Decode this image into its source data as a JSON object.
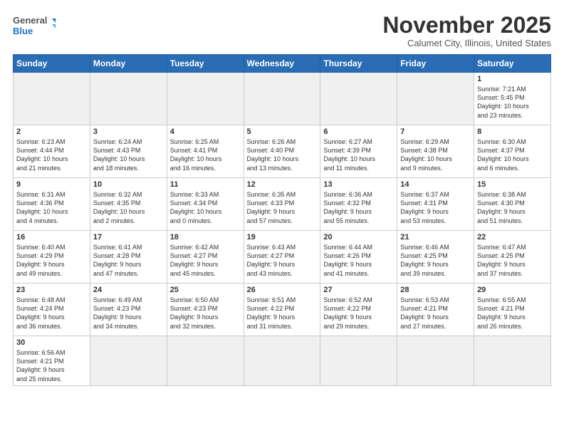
{
  "logo": {
    "text_general": "General",
    "text_blue": "Blue"
  },
  "title": "November 2025",
  "subtitle": "Calumet City, Illinois, United States",
  "weekdays": [
    "Sunday",
    "Monday",
    "Tuesday",
    "Wednesday",
    "Thursday",
    "Friday",
    "Saturday"
  ],
  "weeks": [
    [
      {
        "day": "",
        "info": ""
      },
      {
        "day": "",
        "info": ""
      },
      {
        "day": "",
        "info": ""
      },
      {
        "day": "",
        "info": ""
      },
      {
        "day": "",
        "info": ""
      },
      {
        "day": "",
        "info": ""
      },
      {
        "day": "1",
        "info": "Sunrise: 7:21 AM\nSunset: 5:45 PM\nDaylight: 10 hours\nand 23 minutes."
      }
    ],
    [
      {
        "day": "2",
        "info": "Sunrise: 6:23 AM\nSunset: 4:44 PM\nDaylight: 10 hours\nand 21 minutes."
      },
      {
        "day": "3",
        "info": "Sunrise: 6:24 AM\nSunset: 4:43 PM\nDaylight: 10 hours\nand 18 minutes."
      },
      {
        "day": "4",
        "info": "Sunrise: 6:25 AM\nSunset: 4:41 PM\nDaylight: 10 hours\nand 16 minutes."
      },
      {
        "day": "5",
        "info": "Sunrise: 6:26 AM\nSunset: 4:40 PM\nDaylight: 10 hours\nand 13 minutes."
      },
      {
        "day": "6",
        "info": "Sunrise: 6:27 AM\nSunset: 4:39 PM\nDaylight: 10 hours\nand 11 minutes."
      },
      {
        "day": "7",
        "info": "Sunrise: 6:29 AM\nSunset: 4:38 PM\nDaylight: 10 hours\nand 9 minutes."
      },
      {
        "day": "8",
        "info": "Sunrise: 6:30 AM\nSunset: 4:37 PM\nDaylight: 10 hours\nand 6 minutes."
      }
    ],
    [
      {
        "day": "9",
        "info": "Sunrise: 6:31 AM\nSunset: 4:36 PM\nDaylight: 10 hours\nand 4 minutes."
      },
      {
        "day": "10",
        "info": "Sunrise: 6:32 AM\nSunset: 4:35 PM\nDaylight: 10 hours\nand 2 minutes."
      },
      {
        "day": "11",
        "info": "Sunrise: 6:33 AM\nSunset: 4:34 PM\nDaylight: 10 hours\nand 0 minutes."
      },
      {
        "day": "12",
        "info": "Sunrise: 6:35 AM\nSunset: 4:33 PM\nDaylight: 9 hours\nand 57 minutes."
      },
      {
        "day": "13",
        "info": "Sunrise: 6:36 AM\nSunset: 4:32 PM\nDaylight: 9 hours\nand 55 minutes."
      },
      {
        "day": "14",
        "info": "Sunrise: 6:37 AM\nSunset: 4:31 PM\nDaylight: 9 hours\nand 53 minutes."
      },
      {
        "day": "15",
        "info": "Sunrise: 6:38 AM\nSunset: 4:30 PM\nDaylight: 9 hours\nand 51 minutes."
      }
    ],
    [
      {
        "day": "16",
        "info": "Sunrise: 6:40 AM\nSunset: 4:29 PM\nDaylight: 9 hours\nand 49 minutes."
      },
      {
        "day": "17",
        "info": "Sunrise: 6:41 AM\nSunset: 4:28 PM\nDaylight: 9 hours\nand 47 minutes."
      },
      {
        "day": "18",
        "info": "Sunrise: 6:42 AM\nSunset: 4:27 PM\nDaylight: 9 hours\nand 45 minutes."
      },
      {
        "day": "19",
        "info": "Sunrise: 6:43 AM\nSunset: 4:27 PM\nDaylight: 9 hours\nand 43 minutes."
      },
      {
        "day": "20",
        "info": "Sunrise: 6:44 AM\nSunset: 4:26 PM\nDaylight: 9 hours\nand 41 minutes."
      },
      {
        "day": "21",
        "info": "Sunrise: 6:46 AM\nSunset: 4:25 PM\nDaylight: 9 hours\nand 39 minutes."
      },
      {
        "day": "22",
        "info": "Sunrise: 6:47 AM\nSunset: 4:25 PM\nDaylight: 9 hours\nand 37 minutes."
      }
    ],
    [
      {
        "day": "23",
        "info": "Sunrise: 6:48 AM\nSunset: 4:24 PM\nDaylight: 9 hours\nand 36 minutes."
      },
      {
        "day": "24",
        "info": "Sunrise: 6:49 AM\nSunset: 4:23 PM\nDaylight: 9 hours\nand 34 minutes."
      },
      {
        "day": "25",
        "info": "Sunrise: 6:50 AM\nSunset: 4:23 PM\nDaylight: 9 hours\nand 32 minutes."
      },
      {
        "day": "26",
        "info": "Sunrise: 6:51 AM\nSunset: 4:22 PM\nDaylight: 9 hours\nand 31 minutes."
      },
      {
        "day": "27",
        "info": "Sunrise: 6:52 AM\nSunset: 4:22 PM\nDaylight: 9 hours\nand 29 minutes."
      },
      {
        "day": "28",
        "info": "Sunrise: 6:53 AM\nSunset: 4:21 PM\nDaylight: 9 hours\nand 27 minutes."
      },
      {
        "day": "29",
        "info": "Sunrise: 6:55 AM\nSunset: 4:21 PM\nDaylight: 9 hours\nand 26 minutes."
      }
    ],
    [
      {
        "day": "30",
        "info": "Sunrise: 6:56 AM\nSunset: 4:21 PM\nDaylight: 9 hours\nand 25 minutes."
      },
      {
        "day": "",
        "info": ""
      },
      {
        "day": "",
        "info": ""
      },
      {
        "day": "",
        "info": ""
      },
      {
        "day": "",
        "info": ""
      },
      {
        "day": "",
        "info": ""
      },
      {
        "day": "",
        "info": ""
      }
    ]
  ]
}
